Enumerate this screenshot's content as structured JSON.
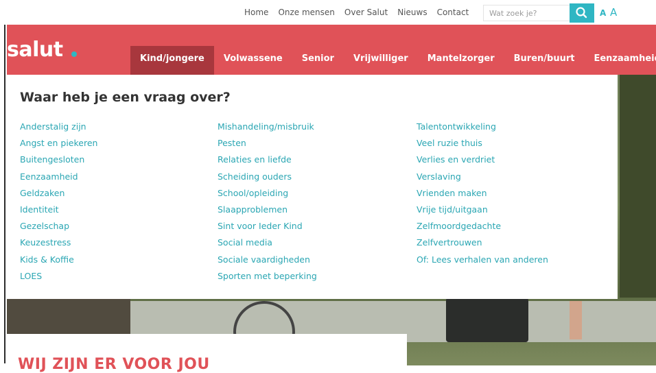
{
  "topbar": {
    "links": [
      "Home",
      "Onze mensen",
      "Over Salut",
      "Nieuws",
      "Contact"
    ],
    "search_placeholder": "Wat zoek je?",
    "search_icon": "search-icon",
    "font_size_small": "A",
    "font_size_large": "A"
  },
  "header": {
    "logo_text": "salut",
    "nav": [
      "Kind/jongere",
      "Volwassene",
      "Senior",
      "Vrijwilliger",
      "Mantelzorger",
      "Buren/buurt",
      "Eenzaamheid"
    ],
    "active_nav": "Kind/jongere"
  },
  "megamenu": {
    "title": "Waar heb je een vraag over?",
    "columns": [
      [
        "Anderstalig zijn",
        "Angst en piekeren",
        "Buitengesloten",
        "Eenzaamheid",
        "Geldzaken",
        "Identiteit",
        "Gezelschap",
        "Keuzestress",
        "Kids & Koffie",
        "LOES"
      ],
      [
        "Mishandeling/misbruik",
        "Pesten",
        "Relaties en liefde",
        "Scheiding ouders",
        "School/opleiding",
        "Slaapproblemen",
        "Sint voor Ieder Kind",
        "Social media",
        "Sociale vaardigheden",
        "Sporten met beperking"
      ],
      [
        "Talentontwikkeling",
        "Veel ruzie thuis",
        "Verlies en verdriet",
        "Verslaving",
        "Vrienden maken",
        "Vrije tijd/uitgaan",
        "Zelfmoordgedachte",
        "Zelfvertrouwen",
        "Of: Lees verhalen van anderen"
      ]
    ]
  },
  "content": {
    "heading": "WIJ ZIJN ER VOOR JOU"
  },
  "colors": {
    "brand_red": "#e05258",
    "active_red": "#a8373d",
    "teal": "#2fb6c3",
    "link_teal": "#2aa6b3"
  }
}
